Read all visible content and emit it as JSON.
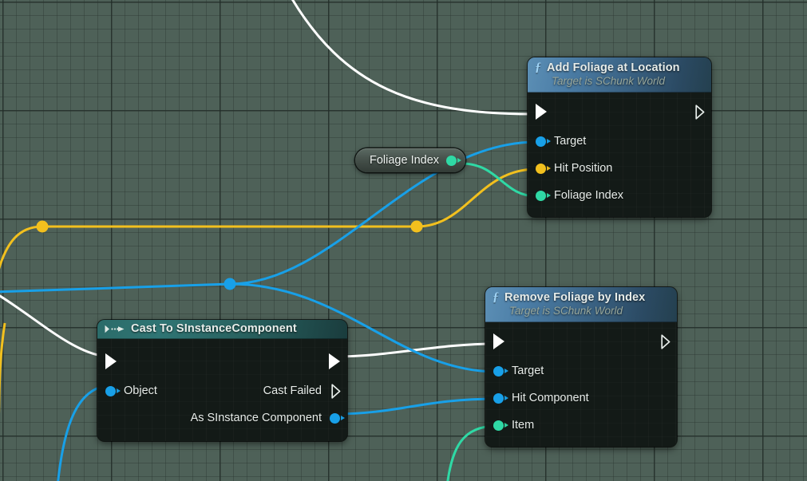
{
  "graph": {
    "name": "blueprint-event-graph",
    "background_color": "#4e6158",
    "grid_line_color": "#26322d",
    "grid_major_color": "#1c2622"
  },
  "colors": {
    "exec_white": "#ffffff",
    "object_blue": "#18a0e8",
    "vector_yellow": "#f2c01e",
    "integer_green": "#2fd9a5",
    "node_body": "#131a17",
    "fn_header": "#3a6283",
    "cast_header": "#2b6b69"
  },
  "nodes": [
    {
      "id": "add-foliage-at-location",
      "title": "Add Foliage at Location",
      "subtitle": "Target is SChunk World",
      "icon": "function-f-icon",
      "inputs": [
        {
          "label": "",
          "type": "exec",
          "name": "exec-in"
        },
        {
          "label": "Target",
          "type": "object",
          "color": "#18a0e8"
        },
        {
          "label": "Hit Position",
          "type": "vector",
          "color": "#f2c01e"
        },
        {
          "label": "Foliage Index",
          "type": "integer",
          "color": "#2fd9a5"
        }
      ],
      "outputs": [
        {
          "label": "",
          "type": "exec",
          "name": "exec-out",
          "connected": false
        }
      ]
    },
    {
      "id": "remove-foliage-by-index",
      "title": "Remove Foliage by Index",
      "subtitle": "Target is SChunk World",
      "icon": "function-f-icon",
      "inputs": [
        {
          "label": "",
          "type": "exec",
          "name": "exec-in"
        },
        {
          "label": "Target",
          "type": "object",
          "color": "#18a0e8"
        },
        {
          "label": "Hit Component",
          "type": "object",
          "color": "#18a0e8"
        },
        {
          "label": "Item",
          "type": "integer",
          "color": "#2fd9a5"
        }
      ],
      "outputs": [
        {
          "label": "",
          "type": "exec",
          "name": "exec-out",
          "connected": false
        }
      ]
    },
    {
      "id": "cast-to-sinstancecomponent",
      "title": "Cast To SInstanceComponent",
      "icon": "cast-arrow-icon",
      "inputs": [
        {
          "label": "",
          "type": "exec",
          "name": "exec-in"
        },
        {
          "label": "Object",
          "type": "object",
          "color": "#18a0e8"
        }
      ],
      "outputs": [
        {
          "label": "",
          "type": "exec",
          "name": "exec-out",
          "connected": true
        },
        {
          "label": "Cast Failed",
          "type": "exec",
          "connected": false
        },
        {
          "label": "As SInstance Component",
          "type": "object",
          "color": "#18a0e8",
          "connected": true
        }
      ]
    }
  ],
  "getter": {
    "id": "foliage-index-getter",
    "label": "Foliage Index",
    "pin_color": "#2fd9a5"
  }
}
